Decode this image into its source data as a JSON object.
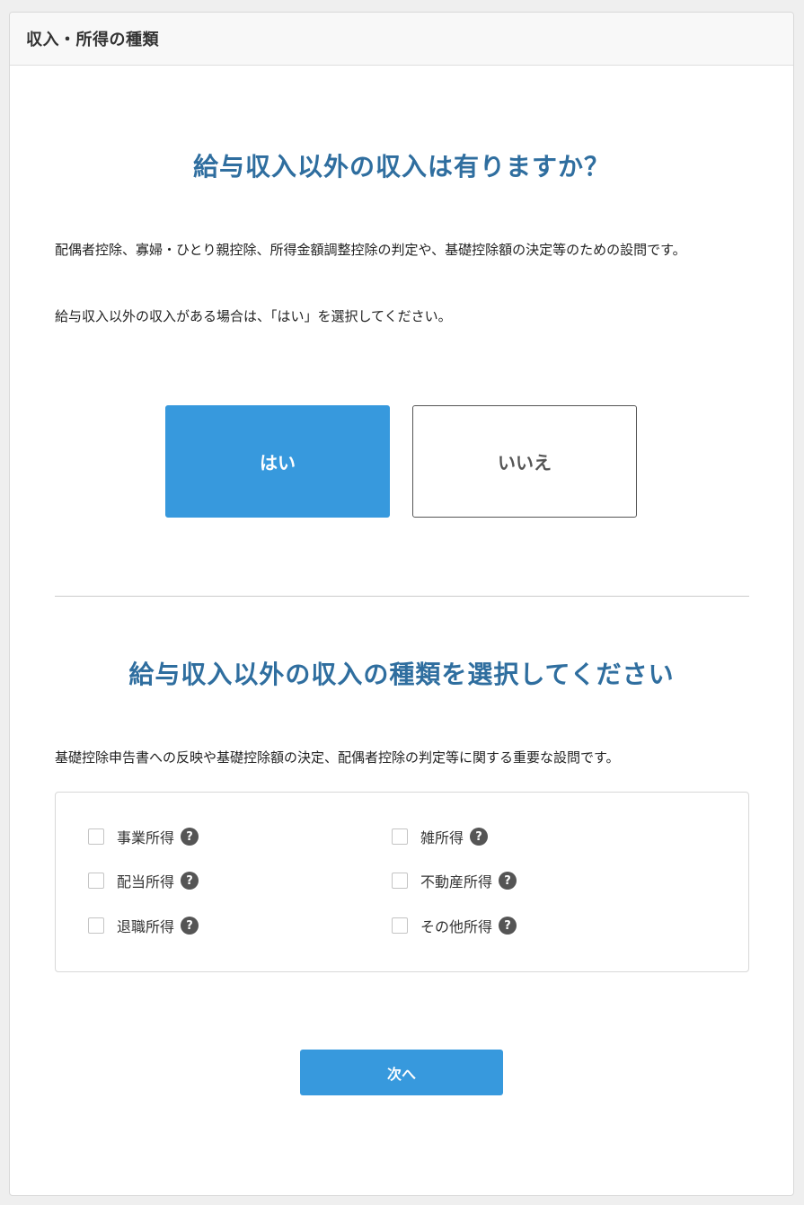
{
  "header": {
    "title": "収入・所得の種類"
  },
  "question1": {
    "heading": "給与収入以外の収入は有りますか？",
    "description": "配偶者控除、寡婦・ひとり親控除、所得金額調整控除の判定や、基礎控除額の決定等のための設問です。",
    "instruction": "給与収入以外の収入がある場合は、「はい」を選択してください。",
    "yes_label": "はい",
    "no_label": "いいえ",
    "selected": "はい"
  },
  "question2": {
    "heading": "給与収入以外の収入の種類を選択してください",
    "description": "基礎控除申告書への反映や基礎控除額の決定、配偶者控除の判定等に関する重要な設問です。",
    "options": [
      {
        "label": "事業所得",
        "checked": false
      },
      {
        "label": "雑所得",
        "checked": false
      },
      {
        "label": "配当所得",
        "checked": false
      },
      {
        "label": "不動産所得",
        "checked": false
      },
      {
        "label": "退職所得",
        "checked": false
      },
      {
        "label": "その他所得",
        "checked": false
      }
    ],
    "help_glyph": "?"
  },
  "footer": {
    "next_label": "次へ"
  },
  "colors": {
    "accent": "#3799dd",
    "heading": "#2f6e9f",
    "help_icon": "#555555"
  },
  "icons": {
    "help": "question-circle-icon",
    "checkbox": "checkbox-unchecked"
  }
}
